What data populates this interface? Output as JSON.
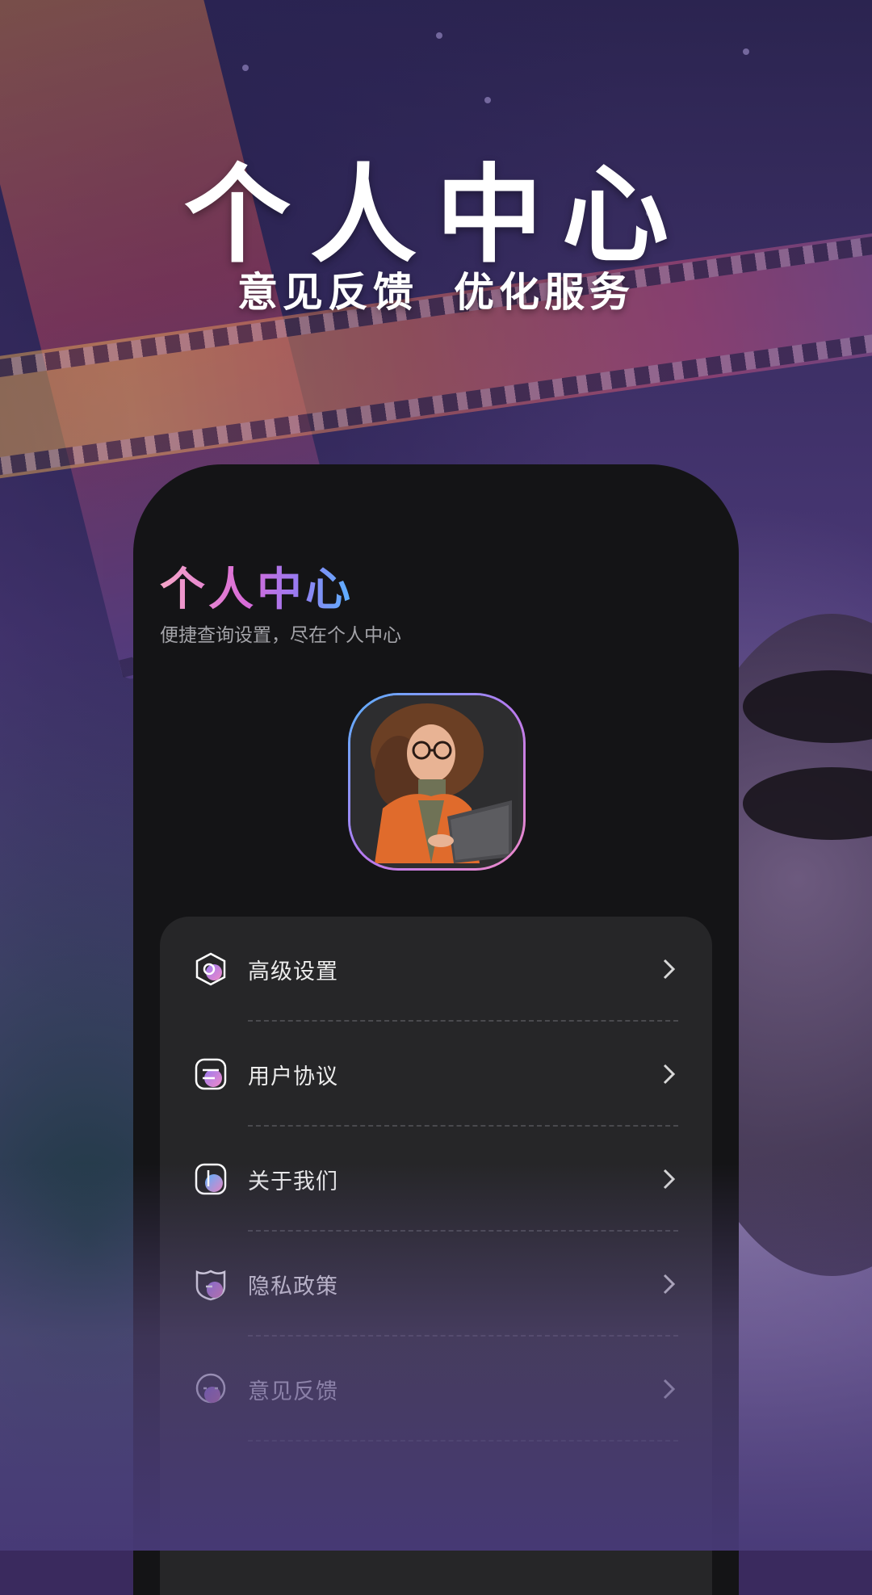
{
  "promo": {
    "headline": "个人中心",
    "subhead_left": "意见反馈",
    "subhead_right": "优化服务"
  },
  "screen": {
    "title": "个人中心",
    "subtitle": "便捷查询设置，尽在个人中心"
  },
  "menu": {
    "items": [
      {
        "label": "高级设置",
        "icon": "settings-hexagon-icon"
      },
      {
        "label": "用户协议",
        "icon": "agreement-icon"
      },
      {
        "label": "关于我们",
        "icon": "info-icon"
      },
      {
        "label": "隐私政策",
        "icon": "shield-icon"
      },
      {
        "label": "意见反馈",
        "icon": "feedback-chat-icon"
      }
    ]
  },
  "colors": {
    "card_bg": "#141416",
    "menu_bg": "#262628",
    "gradient_start": "#f6a6c8",
    "gradient_mid": "#d86ad8",
    "gradient_end": "#58b2ff"
  }
}
